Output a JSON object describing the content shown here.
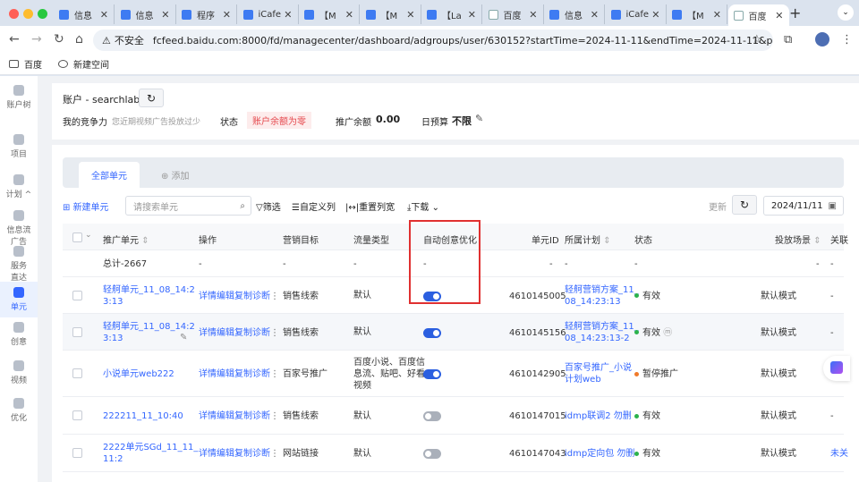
{
  "browser": {
    "tabs": [
      {
        "label": "信息",
        "icon": "doc-icon"
      },
      {
        "label": "信息",
        "icon": "doc-icon"
      },
      {
        "label": "程序",
        "icon": "doc-icon"
      },
      {
        "label": "iCafe",
        "icon": "icafe-icon"
      },
      {
        "label": "【M",
        "icon": "doc-icon"
      },
      {
        "label": "【M",
        "icon": "doc-icon"
      },
      {
        "label": "【La",
        "icon": "doc-icon"
      },
      {
        "label": "百度",
        "icon": "baidu-icon"
      },
      {
        "label": "信息",
        "icon": "doc-icon"
      },
      {
        "label": "iCafe",
        "icon": "icafe-icon"
      },
      {
        "label": "【M",
        "icon": "doc-icon"
      },
      {
        "label": "百度",
        "icon": "baidu-icon",
        "active": true
      }
    ],
    "security_label": "不安全",
    "url": "fcfeed.baidu.com:8000/fd/managecenter/dashboard/adgroups/user/630152?startTime=2024-11-11&endTime=2024-11-11&pageSize=50&page...",
    "bookmarks": [
      "百度",
      "新建空间"
    ]
  },
  "sidebar": {
    "items": [
      {
        "label": "账户树",
        "icon": "menu-icon"
      },
      {
        "label": "项目",
        "icon": "project-icon"
      },
      {
        "label": "计划 ^",
        "icon": "plan-icon"
      },
      {
        "label": "信息流",
        "label2": "广告",
        "icon": "feed-icon"
      },
      {
        "label": "服务",
        "label2": "直达",
        "icon": "service-icon"
      },
      {
        "label": "单元",
        "icon": "unit-icon",
        "active": true
      },
      {
        "label": "创意",
        "icon": "creative-icon"
      },
      {
        "label": "视频",
        "icon": "video-icon"
      },
      {
        "label": "优化",
        "icon": "optimize-icon"
      }
    ]
  },
  "account": {
    "title": "账户 - searchlab",
    "competitiveness_label": "我的竞争力",
    "competitiveness_hint": "您近期视频广告投放过少",
    "status_label": "状态",
    "status_value": "账户余额为零",
    "balance_label": "推广余额",
    "balance_value": "0.00",
    "budget_label": "日预算",
    "budget_value": "不限"
  },
  "tabs": {
    "all_units": "全部单元",
    "add": "⊕ 添加"
  },
  "toolbar": {
    "new_unit": "新建单元",
    "search_placeholder": "请搜索单元",
    "filter": "筛选",
    "custom_columns": "自定义列",
    "reset_width": "重置列宽",
    "download": "下载",
    "update": "更新",
    "date": "2024/11/11"
  },
  "table": {
    "headers": [
      "推广单元",
      "操作",
      "营销目标",
      "流量类型",
      "自动创意优化",
      "单元ID",
      "所属计划",
      "状态",
      "投放场景",
      "关联"
    ],
    "total_row": {
      "name": "总计-2667",
      "op": "-",
      "goal": "-",
      "traffic": "-",
      "auto": "-",
      "id": "-",
      "plan": "-",
      "status": "-",
      "scene": "-",
      "rel": "-"
    },
    "actions": [
      "详情",
      "编辑",
      "复制",
      "诊断"
    ],
    "rows": [
      {
        "name": [
          "轻舸单元_11_08_14:2",
          "3:13"
        ],
        "goal": "销售线索",
        "traffic": [
          "默认"
        ],
        "auto": "on",
        "id": "4610145005",
        "plan": [
          "轻舸营销方案_11_",
          "08_14:23:13"
        ],
        "status": "有效",
        "status_color": "#2bb24c",
        "scene": "默认模式",
        "rel": "-"
      },
      {
        "name": [
          "轻舸单元_11_08_14:2",
          "3:13"
        ],
        "goal": "销售线索",
        "traffic": [
          "默认"
        ],
        "auto": "on",
        "id": "4610145156",
        "plan": [
          "轻舸营销方案_11_",
          "08_14:23:13-2"
        ],
        "status": "有效",
        "status_color": "#2bb24c",
        "scene": "默认模式",
        "rel": "-"
      },
      {
        "name": [
          "小说单元web222"
        ],
        "goal": "百家号推广",
        "traffic": [
          "百度小说、百度信",
          "息流、贴吧、好看",
          "视频"
        ],
        "auto": "on",
        "id": "4610142905",
        "plan": [
          "百家号推广_小说",
          "计划web"
        ],
        "status": "暂停推广",
        "status_color": "#f07a2a",
        "scene": "默认模式",
        "rel": ""
      },
      {
        "name": [
          "222211_11_10:40"
        ],
        "goal": "销售线索",
        "traffic": [
          "默认"
        ],
        "auto": "off",
        "id": "4610147015",
        "plan": [
          "idmp联调2 勿删"
        ],
        "status": "有效",
        "status_color": "#2bb24c",
        "scene": "默认模式",
        "rel": "-"
      },
      {
        "name": [
          "2222单元SGd_11_11_",
          "11:2"
        ],
        "goal": "网站链接",
        "traffic": [
          "默认"
        ],
        "auto": "off",
        "id": "4610147043",
        "plan": [
          "idmp定向包 勿删"
        ],
        "status": "有效",
        "status_color": "#2bb24c",
        "scene": "默认模式",
        "rel": "未关"
      }
    ]
  }
}
